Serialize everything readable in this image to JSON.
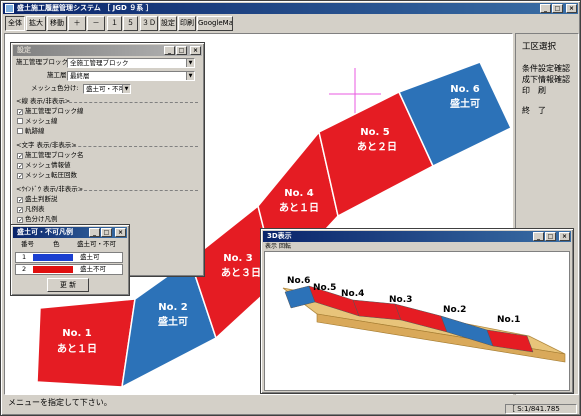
{
  "main_window": {
    "title": "盛土施工履歴管理システム ［ JGD ９系 ］",
    "toolbar": [
      "全体",
      "拡大",
      "移動",
      "＋",
      "－",
      "１",
      "５",
      "３Ｄ",
      "設定",
      "印刷",
      "GoogleMap"
    ],
    "status_message": "メニューを指定して下さい。",
    "scale": "［ S:1/841.785"
  },
  "side_menu": {
    "items": [
      "工区選択",
      "条件設定確認",
      "成下情報確認",
      "印　刷",
      "終　了"
    ]
  },
  "settings_dialog": {
    "title": "設定",
    "block_label": "施工管理ブロック:",
    "block_value": "全施工管理ブロック",
    "layer_label": "施工層:",
    "layer_value": "最終層",
    "mesh_label": "メッシュ色分け:",
    "mesh_value": "盛土可・不可",
    "line_header": "<線 表示/非表示>",
    "line_items": [
      {
        "label": "施工管理ブロック線",
        "checked": true
      },
      {
        "label": "メッシュ線",
        "checked": false
      },
      {
        "label": "軌跡線",
        "checked": false
      }
    ],
    "text_header": "<文字 表示/非表示>",
    "text_items": [
      {
        "label": "施工管理ブロック名",
        "checked": true
      },
      {
        "label": "メッシュ情報値",
        "checked": true
      },
      {
        "label": "メッシュ転圧回数",
        "checked": true
      }
    ],
    "wink_header": "<ｳｲﾝﾄﾞｳ 表示/非表示>",
    "wink_items": [
      {
        "label": "盛土判断説",
        "checked": true
      },
      {
        "label": "凡例表",
        "checked": true
      },
      {
        "label": "色分け凡例",
        "checked": true
      }
    ]
  },
  "legend_dialog": {
    "title": "盛土可・不可凡例",
    "headers": [
      "番号",
      "色",
      "盛土可・不可"
    ],
    "rows": [
      {
        "num": "1",
        "color": "#1a3fd0",
        "label": "盛土可"
      },
      {
        "num": "2",
        "color": "#e01010",
        "label": "盛土不可"
      }
    ],
    "update_button": "更 新"
  },
  "map": {
    "blocks": [
      {
        "name": "No. 1",
        "sub": "あと１日",
        "color": "#e51c23"
      },
      {
        "name": "No. 2",
        "sub": "盛土可",
        "color": "#2c72b8"
      },
      {
        "name": "No. 3",
        "sub": "あと３日",
        "color": "#e51c23"
      },
      {
        "name": "No. 4",
        "sub": "あと１日",
        "color": "#e51c23"
      },
      {
        "name": "No. 5",
        "sub": "あと２日",
        "color": "#e51c23"
      },
      {
        "name": "No. 6",
        "sub": "盛土可",
        "color": "#2c72b8"
      }
    ]
  },
  "view3d": {
    "title": "3D表示",
    "menu": [
      "表示",
      "回転"
    ],
    "labels": [
      "No.6",
      "No.5",
      "No.4",
      "No.3",
      "No.2",
      "No.1"
    ]
  }
}
